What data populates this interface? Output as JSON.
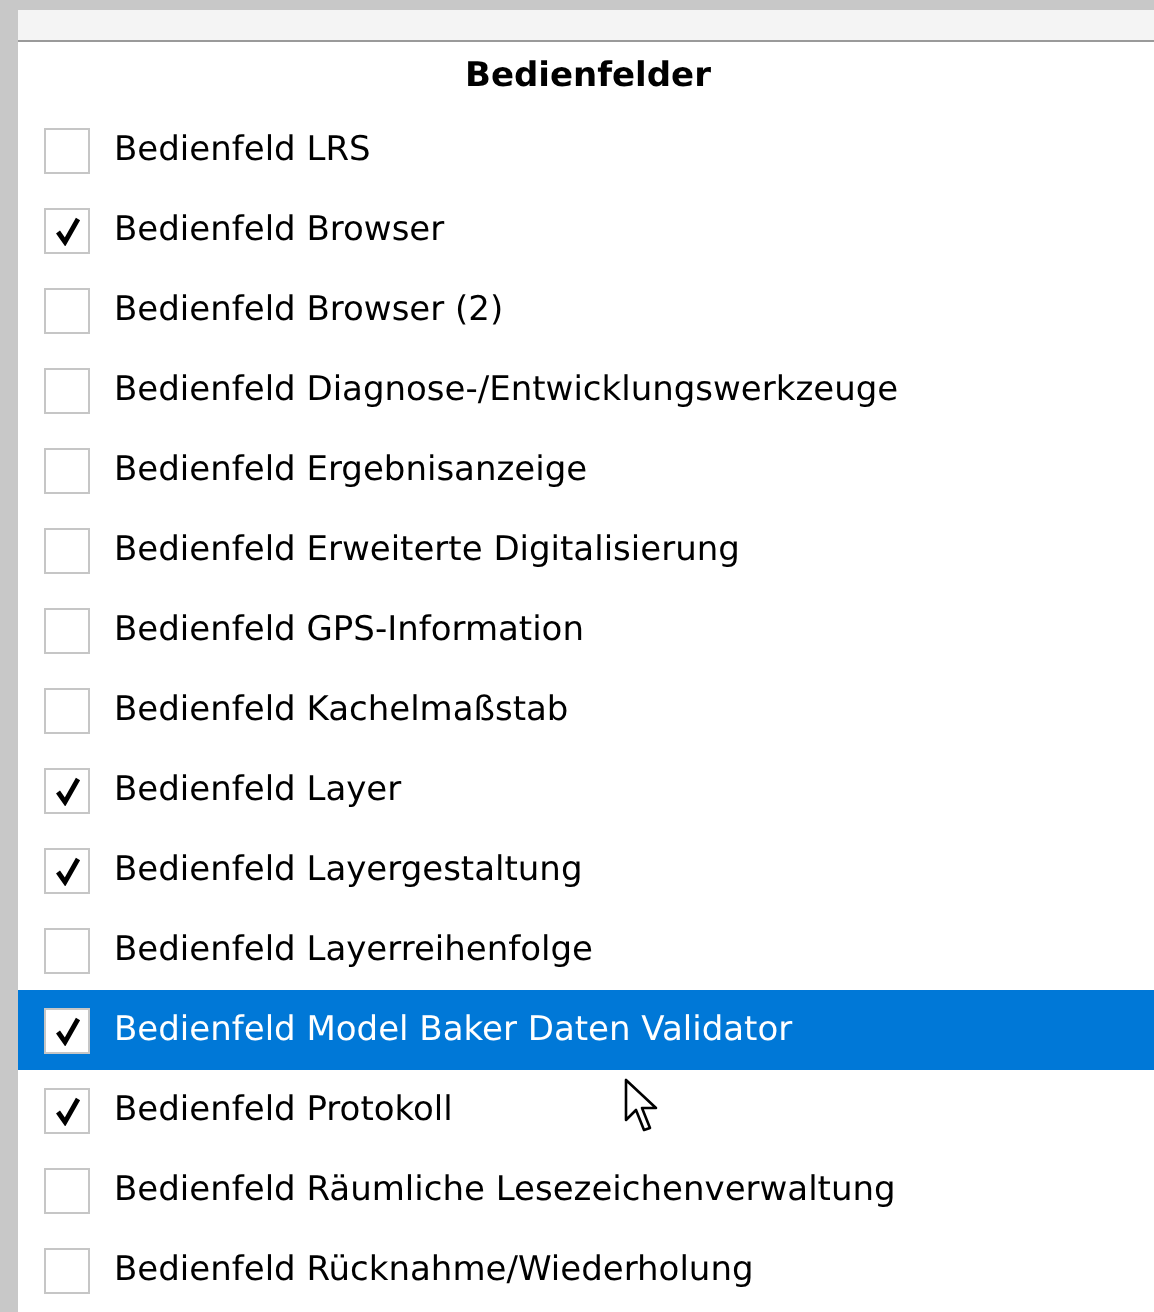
{
  "menu": {
    "title": "Bedienfelder",
    "items": [
      {
        "label": "Bedienfeld LRS",
        "checked": false,
        "selected": false
      },
      {
        "label": "Bedienfeld Browser",
        "checked": true,
        "selected": false
      },
      {
        "label": "Bedienfeld Browser (2)",
        "checked": false,
        "selected": false
      },
      {
        "label": "Bedienfeld Diagnose-/Entwicklungswerkzeuge",
        "checked": false,
        "selected": false
      },
      {
        "label": "Bedienfeld Ergebnisanzeige",
        "checked": false,
        "selected": false
      },
      {
        "label": "Bedienfeld Erweiterte Digitalisierung",
        "checked": false,
        "selected": false
      },
      {
        "label": "Bedienfeld GPS-Information",
        "checked": false,
        "selected": false
      },
      {
        "label": "Bedienfeld Kachelmaßstab",
        "checked": false,
        "selected": false
      },
      {
        "label": "Bedienfeld Layer",
        "checked": true,
        "selected": false
      },
      {
        "label": "Bedienfeld Layergestaltung",
        "checked": true,
        "selected": false
      },
      {
        "label": "Bedienfeld Layerreihenfolge",
        "checked": false,
        "selected": false
      },
      {
        "label": "Bedienfeld Model Baker Daten Validator",
        "checked": true,
        "selected": true
      },
      {
        "label": "Bedienfeld Protokoll",
        "checked": true,
        "selected": false
      },
      {
        "label": "Bedienfeld Räumliche Lesezeichenverwaltung",
        "checked": false,
        "selected": false
      },
      {
        "label": "Bedienfeld Rücknahme/Wiederholung",
        "checked": false,
        "selected": false
      }
    ]
  }
}
